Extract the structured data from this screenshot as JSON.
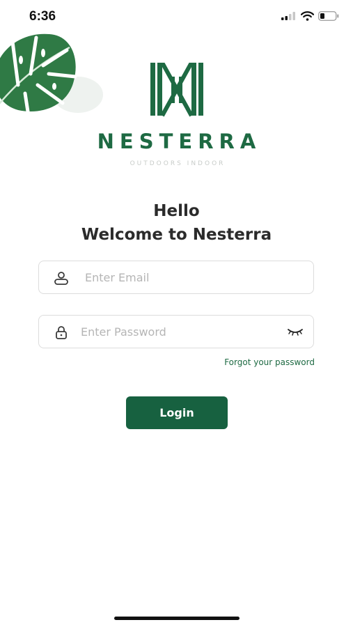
{
  "status_bar": {
    "time": "6:36",
    "icons": [
      "cellular-signal-icon",
      "wifi-icon",
      "battery-icon"
    ]
  },
  "brand": {
    "name": "NESTERRA",
    "tagline": "OUTDOORS INDOOR",
    "logo_icon": "nesterra-monogram-icon",
    "decoration_icon": "monstera-leaf-icon"
  },
  "greeting": {
    "line1": "Hello",
    "line2": "Welcome to Nesterra"
  },
  "form": {
    "email": {
      "placeholder": "Enter Email",
      "value": "",
      "icon": "user-icon"
    },
    "password": {
      "placeholder": "Enter Password",
      "value": "",
      "icon": "lock-icon",
      "toggle_icon": "eye-closed-icon"
    },
    "forgot_label": "Forgot your password",
    "login_label": "Login"
  },
  "colors": {
    "brand_green": "#1e6a43",
    "button_green": "#176140",
    "placeholder_gray": "#b5b5b5",
    "border_gray": "#dcdcdc"
  }
}
